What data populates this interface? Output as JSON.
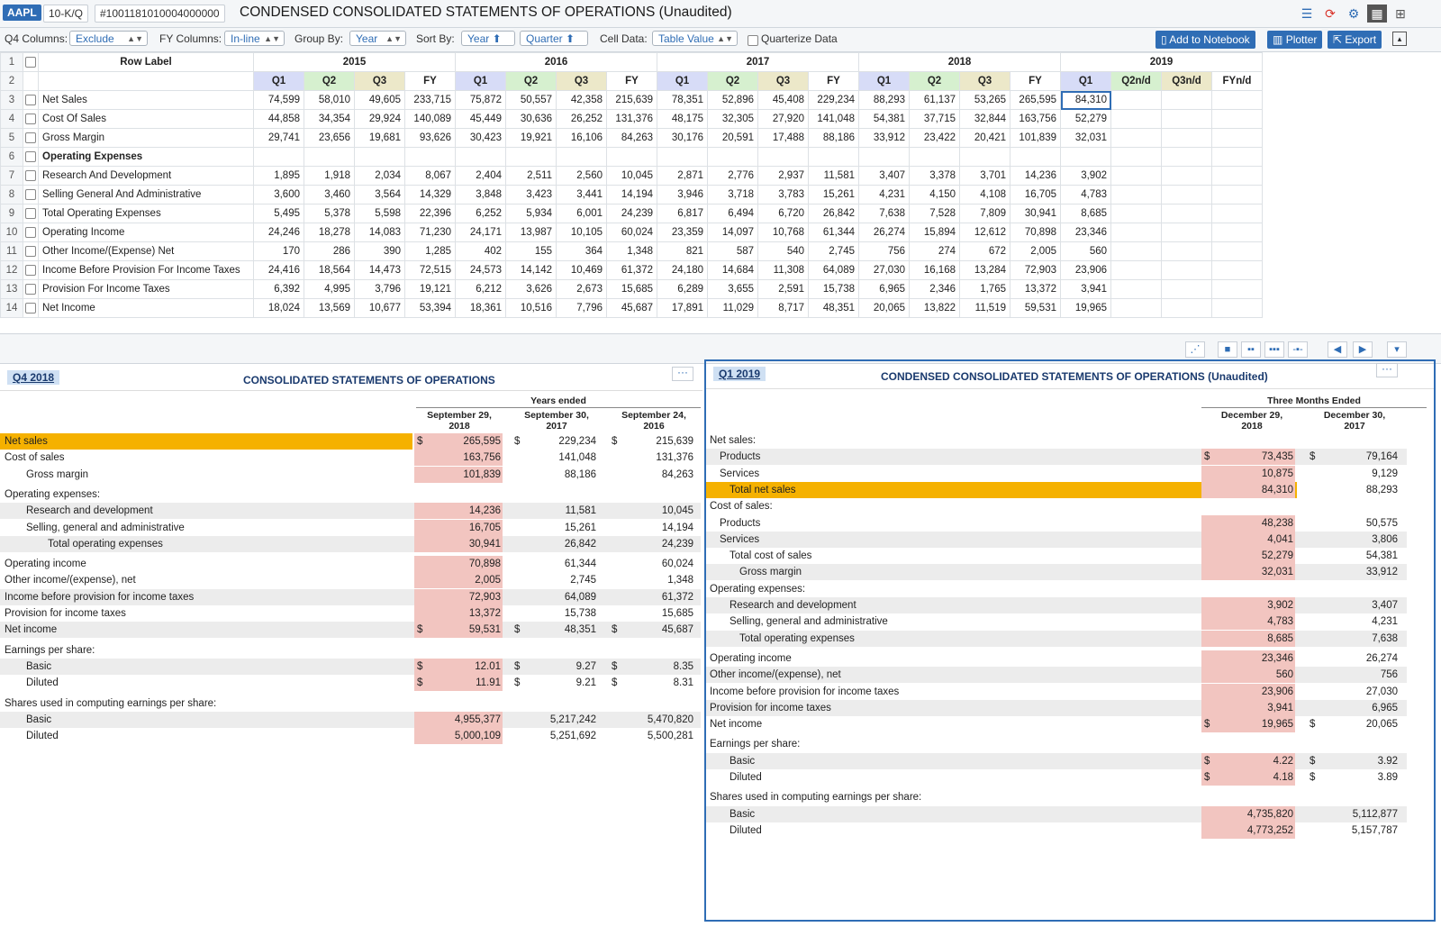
{
  "header": {
    "ticker": "AAPL",
    "form": "10-K/Q",
    "accession": "#1001181010004000000",
    "title": "CONDENSED CONSOLIDATED STATEMENTS OF OPERATIONS (Unaudited)"
  },
  "options": {
    "q4_columns_label": "Q4 Columns:",
    "q4_columns_value": "Exclude",
    "fy_columns_label": "FY Columns:",
    "fy_columns_value": "In-line",
    "group_by_label": "Group By:",
    "group_by_value": "Year",
    "sort_by_label": "Sort By:",
    "sort_year": "Year ⬆",
    "sort_quarter": "Quarter ⬆",
    "cell_data_label": "Cell Data:",
    "cell_data_value": "Table Value",
    "quarterize_label": "Quarterize Data",
    "add_notebook": "Add to Notebook",
    "plotter": "Plotter",
    "export": "Export"
  },
  "grid": {
    "row_label_header": "Row Label",
    "years": [
      "2015",
      "2016",
      "2017",
      "2018",
      "2019"
    ],
    "year_colors": [
      "#ffffff",
      "#ffffff",
      "#ffffff",
      "#ffffff",
      "#ffffff"
    ],
    "quarter_headers": [
      "Q1",
      "Q2",
      "Q3",
      "FY",
      "Q1",
      "Q2",
      "Q3",
      "FY",
      "Q1",
      "Q2",
      "Q3",
      "FY",
      "Q1",
      "Q2",
      "Q3",
      "FY",
      "Q1",
      "Q2n/d",
      "Q3n/d",
      "FYn/d"
    ],
    "rows": [
      {
        "n": "3",
        "label": "Net Sales",
        "bold": false,
        "vals": [
          "74,599",
          "58,010",
          "49,605",
          "233,715",
          "75,872",
          "50,557",
          "42,358",
          "215,639",
          "78,351",
          "52,896",
          "45,408",
          "229,234",
          "88,293",
          "61,137",
          "53,265",
          "265,595",
          "84,310",
          "",
          "",
          ""
        ]
      },
      {
        "n": "4",
        "label": "Cost Of Sales",
        "bold": false,
        "vals": [
          "44,858",
          "34,354",
          "29,924",
          "140,089",
          "45,449",
          "30,636",
          "26,252",
          "131,376",
          "48,175",
          "32,305",
          "27,920",
          "141,048",
          "54,381",
          "37,715",
          "32,844",
          "163,756",
          "52,279",
          "",
          "",
          ""
        ]
      },
      {
        "n": "5",
        "label": "Gross Margin",
        "bold": false,
        "vals": [
          "29,741",
          "23,656",
          "19,681",
          "93,626",
          "30,423",
          "19,921",
          "16,106",
          "84,263",
          "30,176",
          "20,591",
          "17,488",
          "88,186",
          "33,912",
          "23,422",
          "20,421",
          "101,839",
          "32,031",
          "",
          "",
          ""
        ]
      },
      {
        "n": "6",
        "label": "Operating Expenses",
        "bold": true,
        "vals": [
          "",
          "",
          "",
          "",
          "",
          "",
          "",
          "",
          "",
          "",
          "",
          "",
          "",
          "",
          "",
          "",
          "",
          "",
          "",
          ""
        ]
      },
      {
        "n": "7",
        "label": "Research And Development",
        "bold": false,
        "vals": [
          "1,895",
          "1,918",
          "2,034",
          "8,067",
          "2,404",
          "2,511",
          "2,560",
          "10,045",
          "2,871",
          "2,776",
          "2,937",
          "11,581",
          "3,407",
          "3,378",
          "3,701",
          "14,236",
          "3,902",
          "",
          "",
          ""
        ]
      },
      {
        "n": "8",
        "label": "Selling General And Administrative",
        "bold": false,
        "vals": [
          "3,600",
          "3,460",
          "3,564",
          "14,329",
          "3,848",
          "3,423",
          "3,441",
          "14,194",
          "3,946",
          "3,718",
          "3,783",
          "15,261",
          "4,231",
          "4,150",
          "4,108",
          "16,705",
          "4,783",
          "",
          "",
          ""
        ]
      },
      {
        "n": "9",
        "label": "Total Operating Expenses",
        "bold": false,
        "vals": [
          "5,495",
          "5,378",
          "5,598",
          "22,396",
          "6,252",
          "5,934",
          "6,001",
          "24,239",
          "6,817",
          "6,494",
          "6,720",
          "26,842",
          "7,638",
          "7,528",
          "7,809",
          "30,941",
          "8,685",
          "",
          "",
          ""
        ]
      },
      {
        "n": "10",
        "label": "Operating Income",
        "bold": false,
        "vals": [
          "24,246",
          "18,278",
          "14,083",
          "71,230",
          "24,171",
          "13,987",
          "10,105",
          "60,024",
          "23,359",
          "14,097",
          "10,768",
          "61,344",
          "26,274",
          "15,894",
          "12,612",
          "70,898",
          "23,346",
          "",
          "",
          ""
        ]
      },
      {
        "n": "11",
        "label": "Other Income/(Expense) Net",
        "bold": false,
        "vals": [
          "170",
          "286",
          "390",
          "1,285",
          "402",
          "155",
          "364",
          "1,348",
          "821",
          "587",
          "540",
          "2,745",
          "756",
          "274",
          "672",
          "2,005",
          "560",
          "",
          "",
          ""
        ]
      },
      {
        "n": "12",
        "label": "Income Before Provision For Income Taxes",
        "bold": false,
        "vals": [
          "24,416",
          "18,564",
          "14,473",
          "72,515",
          "24,573",
          "14,142",
          "10,469",
          "61,372",
          "24,180",
          "14,684",
          "11,308",
          "64,089",
          "27,030",
          "16,168",
          "13,284",
          "72,903",
          "23,906",
          "",
          "",
          ""
        ]
      },
      {
        "n": "13",
        "label": "Provision For Income Taxes",
        "bold": false,
        "vals": [
          "6,392",
          "4,995",
          "3,796",
          "19,121",
          "6,212",
          "3,626",
          "2,673",
          "15,685",
          "6,289",
          "3,655",
          "2,591",
          "15,738",
          "6,965",
          "2,346",
          "1,765",
          "13,372",
          "3,941",
          "",
          "",
          ""
        ]
      },
      {
        "n": "14",
        "label": "Net Income",
        "bold": false,
        "vals": [
          "18,024",
          "13,569",
          "10,677",
          "53,394",
          "18,361",
          "10,516",
          "7,796",
          "45,687",
          "17,891",
          "11,029",
          "8,717",
          "48,351",
          "20,065",
          "13,822",
          "11,519",
          "59,531",
          "19,965",
          "",
          "",
          ""
        ]
      }
    ]
  },
  "left_panel": {
    "tag": "Q4 2018",
    "title": "CONSOLIDATED STATEMENTS OF OPERATIONS",
    "group_header": "Years ended",
    "col1": "September 29,\n2018",
    "col2": "September 30,\n2017",
    "col3": "September 24,\n2016",
    "rows": [
      {
        "label": "Net sales",
        "indent": 0,
        "d": "$",
        "v1": "265,595",
        "v2": "229,234",
        "v3": "215,639",
        "hl": true,
        "alt": false
      },
      {
        "label": "Cost of sales",
        "indent": 0,
        "d": "",
        "v1": "163,756",
        "v2": "141,048",
        "v3": "131,376",
        "hl": false,
        "alt": false
      },
      {
        "label": "Gross margin",
        "indent": 1,
        "d": "",
        "v1": "101,839",
        "v2": "88,186",
        "v3": "84,263",
        "hl": false,
        "alt": false
      },
      {
        "label": "Operating expenses:",
        "indent": 0,
        "d": "",
        "v1": "",
        "v2": "",
        "v3": "",
        "hl": false,
        "alt": false
      },
      {
        "label": "Research and development",
        "indent": 1,
        "d": "",
        "v1": "14,236",
        "v2": "11,581",
        "v3": "10,045",
        "hl": false,
        "alt": true
      },
      {
        "label": "Selling, general and administrative",
        "indent": 1,
        "d": "",
        "v1": "16,705",
        "v2": "15,261",
        "v3": "14,194",
        "hl": false,
        "alt": false
      },
      {
        "label": "Total operating expenses",
        "indent": 2,
        "d": "",
        "v1": "30,941",
        "v2": "26,842",
        "v3": "24,239",
        "hl": false,
        "alt": true
      },
      {
        "label": "Operating income",
        "indent": 0,
        "d": "",
        "v1": "70,898",
        "v2": "61,344",
        "v3": "60,024",
        "hl": false,
        "alt": false
      },
      {
        "label": "Other income/(expense), net",
        "indent": 0,
        "d": "",
        "v1": "2,005",
        "v2": "2,745",
        "v3": "1,348",
        "hl": false,
        "alt": false
      },
      {
        "label": "Income before provision for income taxes",
        "indent": 0,
        "d": "",
        "v1": "72,903",
        "v2": "64,089",
        "v3": "61,372",
        "hl": false,
        "alt": true
      },
      {
        "label": "Provision for income taxes",
        "indent": 0,
        "d": "",
        "v1": "13,372",
        "v2": "15,738",
        "v3": "15,685",
        "hl": false,
        "alt": false
      },
      {
        "label": "Net income",
        "indent": 0,
        "d": "$",
        "v1": "59,531",
        "v2": "48,351",
        "v3": "45,687",
        "hl": false,
        "alt": true
      },
      {
        "label": "Earnings per share:",
        "indent": 0,
        "d": "",
        "v1": "",
        "v2": "",
        "v3": "",
        "hl": false,
        "alt": false
      },
      {
        "label": "Basic",
        "indent": 1,
        "d": "$",
        "v1": "12.01",
        "v2": "9.27",
        "v3": "8.35",
        "hl": false,
        "alt": true
      },
      {
        "label": "Diluted",
        "indent": 1,
        "d": "$",
        "v1": "11.91",
        "v2": "9.21",
        "v3": "8.31",
        "hl": false,
        "alt": false
      },
      {
        "label": "Shares used in computing earnings per share:",
        "indent": 0,
        "d": "",
        "v1": "",
        "v2": "",
        "v3": "",
        "hl": false,
        "alt": false
      },
      {
        "label": "Basic",
        "indent": 1,
        "d": "",
        "v1": "4,955,377",
        "v2": "5,217,242",
        "v3": "5,470,820",
        "hl": false,
        "alt": true
      },
      {
        "label": "Diluted",
        "indent": 1,
        "d": "",
        "v1": "5,000,109",
        "v2": "5,251,692",
        "v3": "5,500,281",
        "hl": false,
        "alt": false
      }
    ]
  },
  "right_panel": {
    "tag": "Q1 2019",
    "title": "CONDENSED CONSOLIDATED STATEMENTS OF OPERATIONS (Unaudited)",
    "group_header": "Three Months Ended",
    "col1": "December 29,\n2018",
    "col2": "December 30,\n2017",
    "rows": [
      {
        "label": "Net sales:",
        "indent": 0,
        "d": "",
        "v1": "",
        "v2": "",
        "hl": false,
        "alt": false
      },
      {
        "label": "Products",
        "indent": 1,
        "d": "$",
        "v1": "73,435",
        "v2": "79,164",
        "hl": false,
        "alt": true
      },
      {
        "label": "Services",
        "indent": 1,
        "d": "",
        "v1": "10,875",
        "v2": "9,129",
        "hl": false,
        "alt": false
      },
      {
        "label": "Total net sales",
        "indent": 2,
        "d": "",
        "v1": "84,310",
        "v2": "88,293",
        "hl": true,
        "alt": false
      },
      {
        "label": "Cost of sales:",
        "indent": 0,
        "d": "",
        "v1": "",
        "v2": "",
        "hl": false,
        "alt": false
      },
      {
        "label": "Products",
        "indent": 1,
        "d": "",
        "v1": "48,238",
        "v2": "50,575",
        "hl": false,
        "alt": false
      },
      {
        "label": "Services",
        "indent": 1,
        "d": "",
        "v1": "4,041",
        "v2": "3,806",
        "hl": false,
        "alt": true
      },
      {
        "label": "Total cost of sales",
        "indent": 2,
        "d": "",
        "v1": "52,279",
        "v2": "54,381",
        "hl": false,
        "alt": false
      },
      {
        "label": "Gross margin",
        "indent": 3,
        "d": "",
        "v1": "32,031",
        "v2": "33,912",
        "hl": false,
        "alt": true
      },
      {
        "label": "Operating expenses:",
        "indent": 0,
        "d": "",
        "v1": "",
        "v2": "",
        "hl": false,
        "alt": false
      },
      {
        "label": "Research and development",
        "indent": 2,
        "d": "",
        "v1": "3,902",
        "v2": "3,407",
        "hl": false,
        "alt": true
      },
      {
        "label": "Selling, general and administrative",
        "indent": 2,
        "d": "",
        "v1": "4,783",
        "v2": "4,231",
        "hl": false,
        "alt": false
      },
      {
        "label": "Total operating expenses",
        "indent": 3,
        "d": "",
        "v1": "8,685",
        "v2": "7,638",
        "hl": false,
        "alt": true
      },
      {
        "label": "Operating income",
        "indent": 0,
        "d": "",
        "v1": "23,346",
        "v2": "26,274",
        "hl": false,
        "alt": false
      },
      {
        "label": "Other income/(expense), net",
        "indent": 0,
        "d": "",
        "v1": "560",
        "v2": "756",
        "hl": false,
        "alt": true
      },
      {
        "label": "Income before provision for income taxes",
        "indent": 0,
        "d": "",
        "v1": "23,906",
        "v2": "27,030",
        "hl": false,
        "alt": false
      },
      {
        "label": "Provision for income taxes",
        "indent": 0,
        "d": "",
        "v1": "3,941",
        "v2": "6,965",
        "hl": false,
        "alt": true
      },
      {
        "label": "Net income",
        "indent": 0,
        "d": "$",
        "v1": "19,965",
        "v2": "20,065",
        "hl": false,
        "alt": false
      },
      {
        "label": "Earnings per share:",
        "indent": 0,
        "d": "",
        "v1": "",
        "v2": "",
        "hl": false,
        "alt": false
      },
      {
        "label": "Basic",
        "indent": 2,
        "d": "$",
        "v1": "4.22",
        "v2": "3.92",
        "hl": false,
        "alt": true
      },
      {
        "label": "Diluted",
        "indent": 2,
        "d": "$",
        "v1": "4.18",
        "v2": "3.89",
        "hl": false,
        "alt": false
      },
      {
        "label": "Shares used in computing earnings per share:",
        "indent": 0,
        "d": "",
        "v1": "",
        "v2": "",
        "hl": false,
        "alt": false
      },
      {
        "label": "Basic",
        "indent": 2,
        "d": "",
        "v1": "4,735,820",
        "v2": "5,112,877",
        "hl": false,
        "alt": true
      },
      {
        "label": "Diluted",
        "indent": 2,
        "d": "",
        "v1": "4,773,252",
        "v2": "5,157,787",
        "hl": false,
        "alt": false
      }
    ]
  },
  "colors": {
    "accent": "#2f6db5",
    "highlight": "#f5b100",
    "pink_cell": "#f2c5c0",
    "q1_header": "#d7dcf7",
    "q2_header": "#d6f0cf",
    "q3_header": "#ece8c9",
    "fy_header": "#ffffff"
  }
}
